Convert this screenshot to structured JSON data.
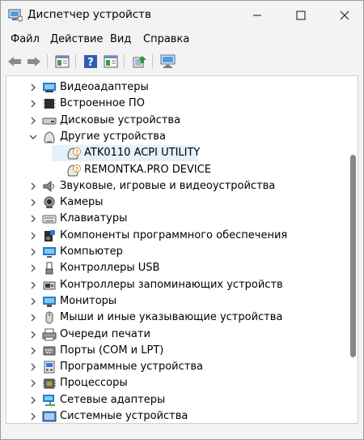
{
  "window": {
    "title": "Диспетчер устройств",
    "accent": "#2b6cd6"
  },
  "menu": [
    {
      "label": "Файл"
    },
    {
      "label": "Действие"
    },
    {
      "label": "Вид"
    },
    {
      "label": "Справка"
    }
  ],
  "toolbar": [
    "back-icon",
    "forward-icon",
    "properties-icon",
    "help-icon",
    "show-hidden-icon",
    "update-driver-icon",
    "scan-hardware-icon"
  ],
  "tree": [
    {
      "label": "Видеоадаптеры",
      "icon": "display-adapter-icon",
      "expanded": false
    },
    {
      "label": "Встроенное ПО",
      "icon": "firmware-icon",
      "expanded": false
    },
    {
      "label": "Дисковые устройства",
      "icon": "disk-drive-icon",
      "expanded": false
    },
    {
      "label": "Другие устройства",
      "icon": "other-devices-icon",
      "expanded": true
    },
    {
      "label": "ATK0110 ACPI UTILITY",
      "icon": "unknown-device-icon",
      "child": true,
      "selected": true
    },
    {
      "label": "REMONTKA.PRO DEVICE",
      "icon": "unknown-device-icon",
      "child": true
    },
    {
      "label": "Звуковые, игровые и видеоустройства",
      "icon": "speaker-icon",
      "expanded": false
    },
    {
      "label": "Камеры",
      "icon": "camera-icon",
      "expanded": false
    },
    {
      "label": "Клавиатуры",
      "icon": "keyboard-icon",
      "expanded": false
    },
    {
      "label": "Компоненты программного обеспечения",
      "icon": "software-component-icon",
      "expanded": false
    },
    {
      "label": "Компьютер",
      "icon": "computer-icon",
      "expanded": false
    },
    {
      "label": "Контроллеры USB",
      "icon": "usb-icon",
      "expanded": false
    },
    {
      "label": "Контроллеры запоминающих устройств",
      "icon": "storage-controller-icon",
      "expanded": false
    },
    {
      "label": "Мониторы",
      "icon": "monitor-icon",
      "expanded": false
    },
    {
      "label": "Мыши и иные указывающие устройства",
      "icon": "mouse-icon",
      "expanded": false
    },
    {
      "label": "Очереди печати",
      "icon": "printer-icon",
      "expanded": false
    },
    {
      "label": "Порты (COM и LPT)",
      "icon": "port-icon",
      "expanded": false
    },
    {
      "label": "Программные устройства",
      "icon": "software-device-icon",
      "expanded": false
    },
    {
      "label": "Процессоры",
      "icon": "processor-icon",
      "expanded": false
    },
    {
      "label": "Сетевые адаптеры",
      "icon": "network-adapter-icon",
      "expanded": false
    },
    {
      "label": "Системные устройства",
      "icon": "system-device-icon",
      "expanded": false
    }
  ]
}
